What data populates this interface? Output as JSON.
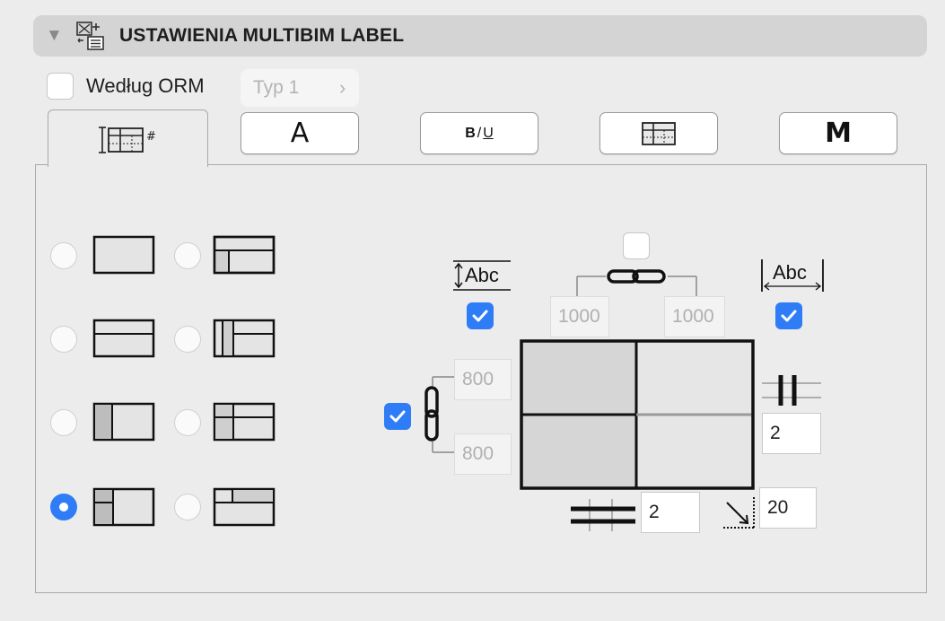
{
  "header": {
    "title": "USTAWIENIA MULTIBIM LABEL",
    "collapse_icon": "disclosure-triangle-icon",
    "panel_icon": "label-settings-icon"
  },
  "orm": {
    "label": "Według ORM",
    "checked": false,
    "type_value": "Typ 1",
    "type_chevron": "›"
  },
  "tabs": [
    {
      "name": "table-layout",
      "icon": "table-layout-icon",
      "active": true
    },
    {
      "name": "font",
      "label": "A",
      "icon": "font-icon",
      "active": false
    },
    {
      "name": "text-style",
      "label_b": "B",
      "label_slash": "/",
      "label_u": "U",
      "icon": "text-style-icon",
      "active": false
    },
    {
      "name": "table-grid",
      "icon": "table-grid-icon",
      "active": false
    },
    {
      "name": "m",
      "label": "M",
      "icon": "m-icon",
      "active": false
    }
  ],
  "layouts": {
    "selected_index": 6,
    "options": [
      {
        "icon": "layout-single-cell-icon"
      },
      {
        "icon": "layout-header-split-bottom-icon"
      },
      {
        "icon": "layout-two-rows-icon"
      },
      {
        "icon": "layout-left-column-split-icon"
      },
      {
        "icon": "layout-left-column-icon"
      },
      {
        "icon": "layout-header-left-column-icon"
      },
      {
        "icon": "layout-left-column-header-icon"
      },
      {
        "icon": "layout-header-right-icon"
      }
    ]
  },
  "dimensions": {
    "height_text_icon_label": "Abc",
    "width_text_icon_label": "Abc",
    "height_text_checked": true,
    "width_text_checked": true,
    "link_widths_checked": false,
    "width_left": "1000",
    "width_right": "1000",
    "link_heights_checked": true,
    "height_top": "800",
    "height_bottom": "800",
    "column_gap": "2",
    "row_gap": "2",
    "corner_value": "20"
  },
  "colors": {
    "accent": "#2f7df6",
    "background": "#ececec",
    "header_bar": "#d4d4d4",
    "cell_shaded": "#d8d8d8"
  }
}
